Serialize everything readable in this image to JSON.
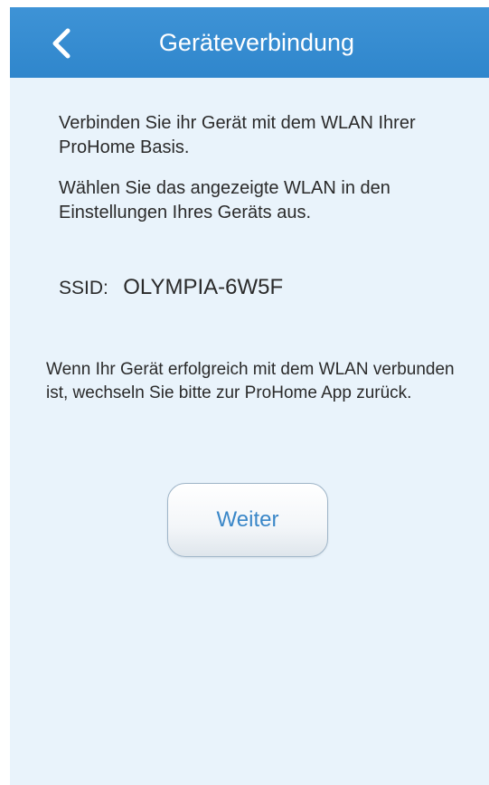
{
  "header": {
    "title": "Geräteverbindung",
    "back_icon": "chevron-left-icon"
  },
  "content": {
    "intro_line": "Verbinden Sie ihr Gerät mit dem WLAN Ihrer ProHome Basis.",
    "instruction": "Wählen Sie das angezeigte WLAN in den Einstellungen Ihres Geräts aus.",
    "ssid_label": "SSID:",
    "ssid_value": "OLYMPIA-6W5F",
    "return_note": "Wenn Ihr Gerät erfolgreich mit dem WLAN verbunden ist, wechseln Sie bitte zur ProHome App zurück."
  },
  "actions": {
    "continue_label": "Weiter"
  },
  "colors": {
    "header_background": "#3590d3",
    "page_background": "#e9f3fb",
    "button_text": "#3a87c8"
  }
}
